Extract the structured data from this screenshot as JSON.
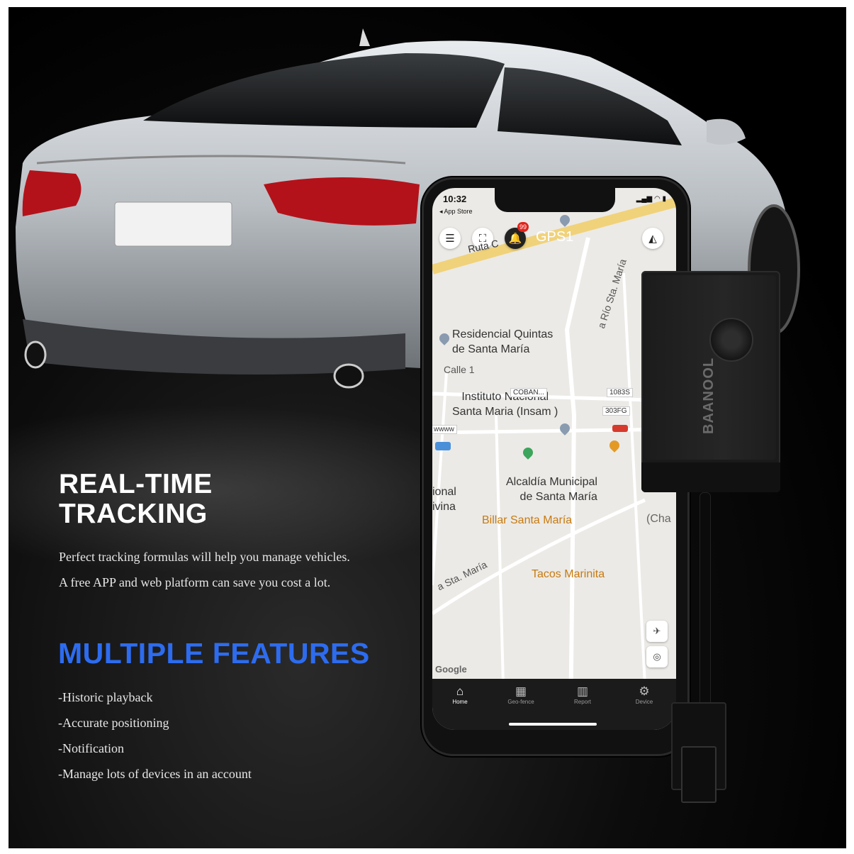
{
  "headline": {
    "line1": "REAL-TIME",
    "line2": "TRACKING"
  },
  "description": {
    "line1": "Perfect tracking formulas will help you manage vehicles.",
    "line2": "A free APP and web platform can save you cost a lot."
  },
  "features": {
    "title": "MULTIPLE FEATURES",
    "title_color": "#2d6cf0",
    "items": [
      "-Historic playback",
      "-Accurate positioning",
      "-Notification",
      "-Manage lots of devices in an account"
    ]
  },
  "phone": {
    "status_time": "10:32",
    "back_label": "◂ App Store",
    "badge": "99",
    "top_text": "GPS1",
    "road_label": "Ruta C",
    "map_labels": {
      "residencial": "Residencial Quintas\nde Santa María",
      "calle": "Calle 1",
      "instituto": "Instituto Nacional\nSanta Maria (Insam )",
      "alcaldia": "Alcaldía Municipal\nde Santa María",
      "billar": "Billar Santa María",
      "tacos": "Tacos Marinita",
      "rio": "a Río Sta. María",
      "sta": "a Sta. María",
      "ional": "ional\nivina",
      "cha": "(Cha"
    },
    "tags": [
      "COBAN...",
      "1083S",
      "303FG",
      "wwww"
    ],
    "google": "Google",
    "tabs": [
      {
        "icon": "home-icon",
        "label": "Home"
      },
      {
        "icon": "geofence-icon",
        "label": "Geo-fence"
      },
      {
        "icon": "report-icon",
        "label": "Report"
      },
      {
        "icon": "device-icon",
        "label": "Device"
      }
    ]
  },
  "device": {
    "brand": "BAANOOL"
  }
}
